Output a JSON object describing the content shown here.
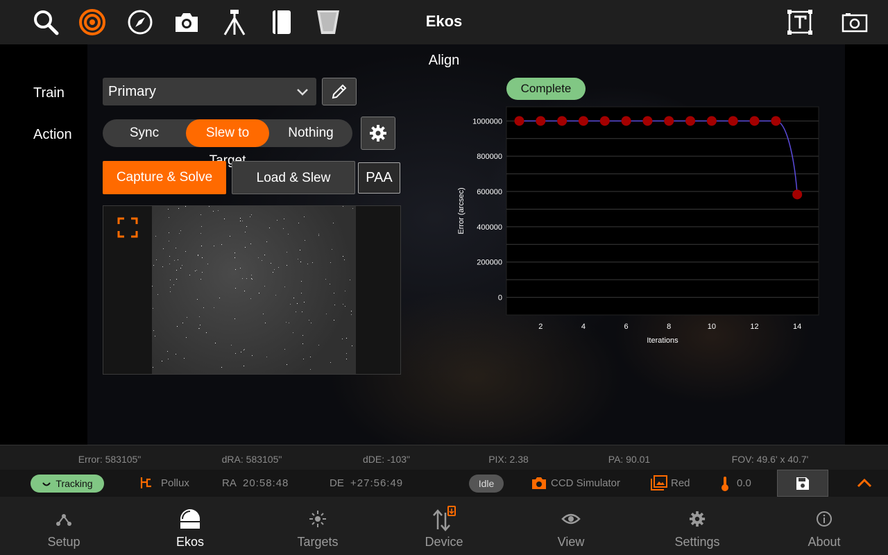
{
  "topbar": {
    "title": "Ekos",
    "icons": [
      "search-icon",
      "target-icon",
      "compass-icon",
      "camera-icon",
      "tripod-icon",
      "notebook-icon",
      "flat-panel-icon",
      "text-frame-icon",
      "screenshot-icon"
    ]
  },
  "align": {
    "section_title": "Align",
    "train_label": "Train",
    "train_value": "Primary",
    "action_label": "Action",
    "actions": [
      "Sync",
      "Slew to Target",
      "Nothing"
    ],
    "active_action": "Slew to Target",
    "capture_label": "Capture & Solve",
    "load_label": "Load & Slew",
    "paa_label": "PAA",
    "status_badge": "Complete"
  },
  "chart_data": {
    "type": "line",
    "ylabel": "Error (arcsec)",
    "xlabel": "Iterations",
    "x": [
      1,
      2,
      3,
      4,
      5,
      6,
      7,
      8,
      9,
      10,
      11,
      12,
      13,
      14
    ],
    "values": [
      1000000,
      1000000,
      1000000,
      1000000,
      1000000,
      1000000,
      1000000,
      1000000,
      1000000,
      1000000,
      1000000,
      1000000,
      1000000,
      583105
    ],
    "yticks": [
      0,
      200000,
      400000,
      600000,
      800000,
      1000000
    ],
    "ytick_labels": [
      "0",
      "200000",
      "400000",
      "600000",
      "800000",
      "1000000"
    ],
    "xticks": [
      2,
      4,
      6,
      8,
      10,
      12,
      14
    ],
    "ylim": [
      -100000,
      1080000
    ],
    "xlim": [
      0.4,
      15
    ],
    "line_color": "#5b4bdb",
    "point_color": "#a30000",
    "grid": true
  },
  "info": {
    "error": "Error: 583105\"",
    "dra": "dRA: 583105\"",
    "dde": "dDE: -103\"",
    "pix": "PIX: 2.38",
    "pa": "PA: 90.01",
    "fov": "FOV: 49.6' x 40.7'"
  },
  "status": {
    "tracking": "Tracking",
    "target": "Pollux",
    "ra_label": "RA",
    "ra_value": "20:58:48",
    "de_label": "DE",
    "de_value": "+27:56:49",
    "idle": "Idle",
    "camera": "CCD Simulator",
    "filter": "Red",
    "temperature": "0.0"
  },
  "nav": {
    "items": [
      "Setup",
      "Ekos",
      "Targets",
      "Device",
      "View",
      "Settings",
      "About"
    ],
    "active": "Ekos"
  },
  "colors": {
    "accent": "#ff6a00",
    "success": "#81c784"
  }
}
